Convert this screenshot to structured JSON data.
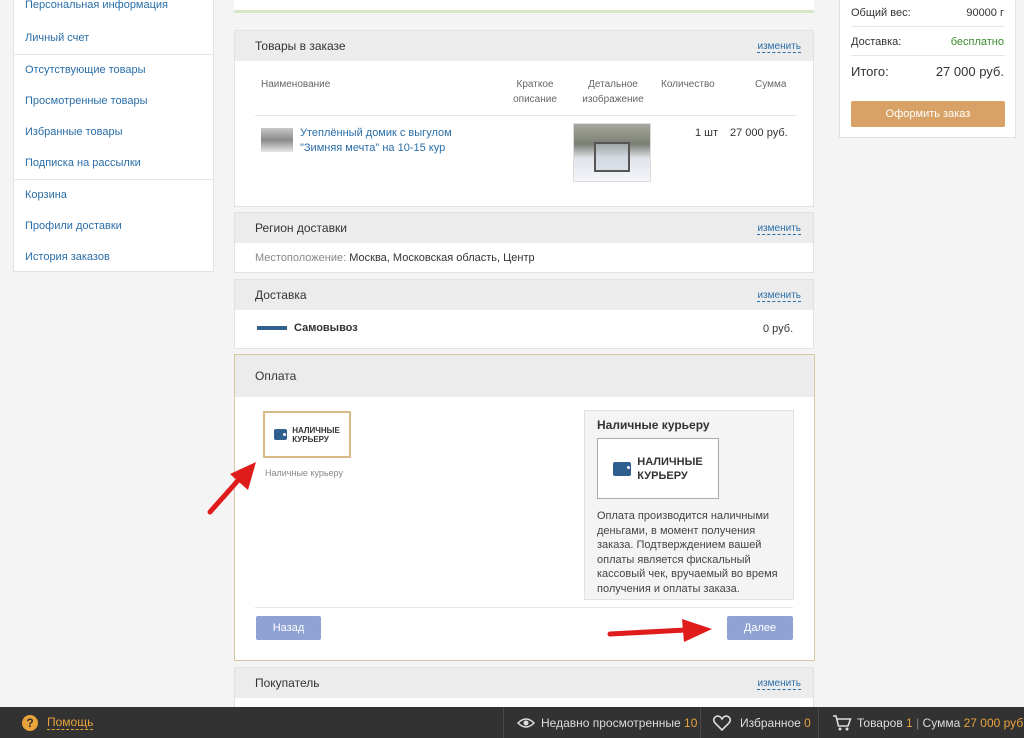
{
  "sidebar": {
    "items": [
      {
        "label": "Персональная информация"
      },
      {
        "label": "Личный счет"
      },
      {
        "label": "Отсутствующие товары"
      },
      {
        "label": "Просмотренные товары"
      },
      {
        "label": "Избранные товары"
      },
      {
        "label": "Подписка на рассылки"
      },
      {
        "label": "Корзина"
      },
      {
        "label": "Профили доставки"
      },
      {
        "label": "История заказов"
      }
    ]
  },
  "order_items": {
    "title": "Товары в заказе",
    "change": "изменить",
    "columns": {
      "name": "Наименование",
      "short": "Краткое описание",
      "detail": "Детальное изображение",
      "qty": "Количество",
      "sum": "Сумма"
    },
    "rows": [
      {
        "name": "Утеплённый домик с выгулом \"Зимняя мечта\" на 10-15 кур",
        "qty": "1 шт",
        "sum": "27 000 руб."
      }
    ]
  },
  "region": {
    "title": "Регион доставки",
    "change": "изменить",
    "location_label": "Местоположение:",
    "location_value": "Москва, Московская область, Центр"
  },
  "delivery": {
    "title": "Доставка",
    "change": "изменить",
    "method": "Самовывоз",
    "price": "0 руб."
  },
  "payment": {
    "title": "Оплата",
    "option_logo_line1": "НАЛИЧНЫЕ",
    "option_logo_line2": "КУРЬЕРУ",
    "option_caption": "Наличные курьеру",
    "info_title": "Наличные курьеру",
    "info_text": "Оплата производится наличными деньгами, в момент получения заказа. Подтверждением вашей оплаты является фискальный кассовый чек, вручаемый во время получения и оплаты заказа.",
    "back": "Назад",
    "next": "Далее"
  },
  "buyer": {
    "title": "Покупатель",
    "change": "изменить"
  },
  "summary": {
    "weight_label": "Общий вес:",
    "weight_value": "90000 г",
    "delivery_label": "Доставка:",
    "delivery_value": "бесплатно",
    "total_label": "Итого:",
    "total_value": "27 000 руб.",
    "order_button": "Оформить заказ"
  },
  "bottom_bar": {
    "help": "Помощь",
    "recent_label": "Недавно просмотренные",
    "recent_count": "10",
    "fav_label": "Избранное",
    "fav_count": "0",
    "goods_label": "Товаров",
    "goods_count": "1",
    "sum_label": "Сумма",
    "sum_value": "27 000 руб."
  },
  "colors": {
    "accent": "#d8a266",
    "link": "#2a6ea8",
    "button": "#8ea2d3",
    "free": "#3b8a2e",
    "arrow": "#e01b1b"
  }
}
